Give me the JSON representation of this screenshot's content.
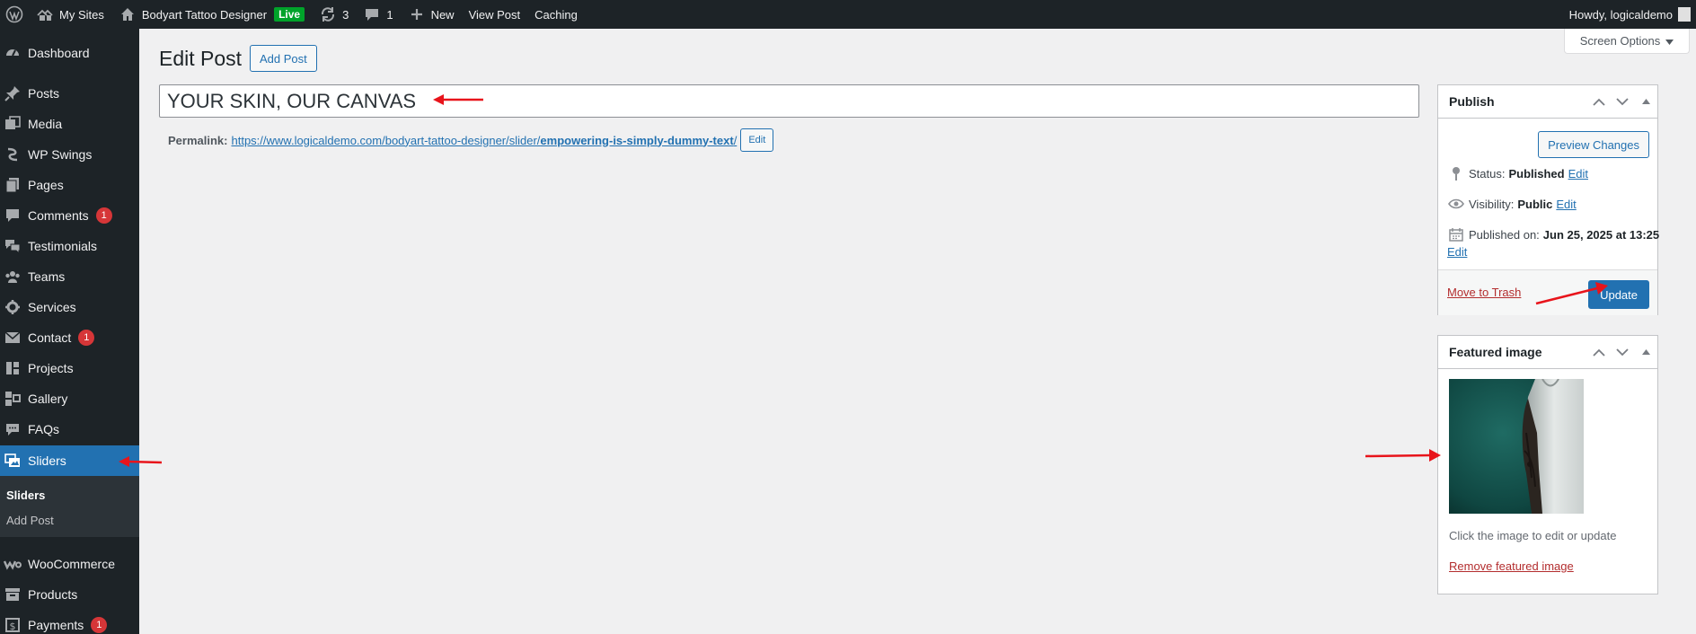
{
  "admin_bar": {
    "my_sites": "My Sites",
    "site_name": "Bodyart Tattoo Designer",
    "live_badge": "Live",
    "updates_count": "3",
    "comments_count": "1",
    "new_label": "New",
    "view_post": "View Post",
    "caching": "Caching",
    "howdy": "Howdy, logicaldemo"
  },
  "sidebar": {
    "items": [
      {
        "label": "Dashboard",
        "icon": "dashboard-icon"
      },
      {
        "label": "Posts",
        "icon": "pin-icon"
      },
      {
        "label": "Media",
        "icon": "media-icon"
      },
      {
        "label": "WP Swings",
        "icon": "swings-icon"
      },
      {
        "label": "Pages",
        "icon": "pages-icon"
      },
      {
        "label": "Comments",
        "icon": "comment-icon",
        "badge": "1"
      },
      {
        "label": "Testimonials",
        "icon": "testimonials-icon"
      },
      {
        "label": "Teams",
        "icon": "groups-icon"
      },
      {
        "label": "Services",
        "icon": "services-icon"
      },
      {
        "label": "Contact",
        "icon": "mail-icon",
        "badge": "1"
      },
      {
        "label": "Projects",
        "icon": "portfolio-icon"
      },
      {
        "label": "Gallery",
        "icon": "gallery-icon"
      },
      {
        "label": "FAQs",
        "icon": "faq-icon"
      },
      {
        "label": "Sliders",
        "icon": "slides-icon"
      },
      {
        "label": "WooCommerce",
        "icon": "woo-icon"
      },
      {
        "label": "Products",
        "icon": "archive-icon"
      },
      {
        "label": "Payments",
        "icon": "payments-icon",
        "badge": "1"
      }
    ],
    "submenu": {
      "current": "Sliders",
      "add": "Add Post"
    }
  },
  "main": {
    "title": "Edit Post",
    "add_post": "Add Post",
    "screen_options": "Screen Options",
    "post_title": "YOUR SKIN, OUR CANVAS",
    "permalink_label": "Permalink:",
    "permalink_base": "https://www.logicaldemo.com/bodyart-tattoo-designer/slider/",
    "permalink_slug": "empowering-is-simply-dummy-text",
    "permalink_slash": "/",
    "edit": "Edit"
  },
  "publish": {
    "title": "Publish",
    "preview": "Preview Changes",
    "status_label": "Status:",
    "status_value": "Published",
    "visibility_label": "Visibility:",
    "visibility_value": "Public",
    "published_label": "Published on:",
    "published_value": "Jun 25, 2025 at 13:25",
    "edit": "Edit",
    "trash": "Move to Trash",
    "update": "Update"
  },
  "featured": {
    "title": "Featured image",
    "hint": "Click the image to edit or update",
    "remove": "Remove featured image"
  },
  "colors": {
    "accent": "#2271b1",
    "sidebar_bg": "#1d2327",
    "annotation_red": "#e8141b"
  }
}
